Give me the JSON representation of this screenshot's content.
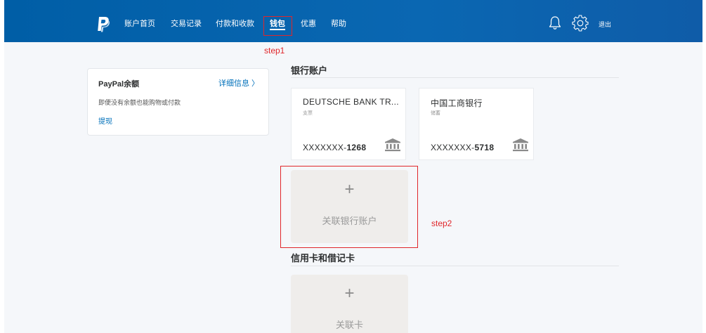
{
  "nav": {
    "items": [
      {
        "label": "账户首页"
      },
      {
        "label": "交易记录"
      },
      {
        "label": "付款和收款"
      },
      {
        "label": "钱包"
      },
      {
        "label": "优惠"
      },
      {
        "label": "帮助"
      }
    ],
    "logout": "退出",
    "active_item": "钱包"
  },
  "annotations": {
    "step1": "step1",
    "step2": "step2"
  },
  "balance": {
    "title": "PayPal余额",
    "details_link": "详细信息 〉",
    "description": "即便没有余额也能购物或付款",
    "withdraw": "提现"
  },
  "bank_section": {
    "title": "银行账户",
    "accounts": [
      {
        "name": "DEUTSCHE BANK TR...",
        "type": "支票",
        "mask": "XXXXXXX-",
        "last4": "1268"
      },
      {
        "name": "中国工商银行",
        "type": "储蓄",
        "mask": "XXXXXXX-",
        "last4": "5718"
      }
    ],
    "link_label": "关联银行账户",
    "plus": "+"
  },
  "card_section": {
    "title": "信用卡和借记卡",
    "link_label": "关联卡",
    "plus": "+"
  },
  "colors": {
    "brand_blue": "#005ea6",
    "link": "#0070ba",
    "annotation_red": "#e0262a",
    "tile_bg": "#efedeb"
  }
}
